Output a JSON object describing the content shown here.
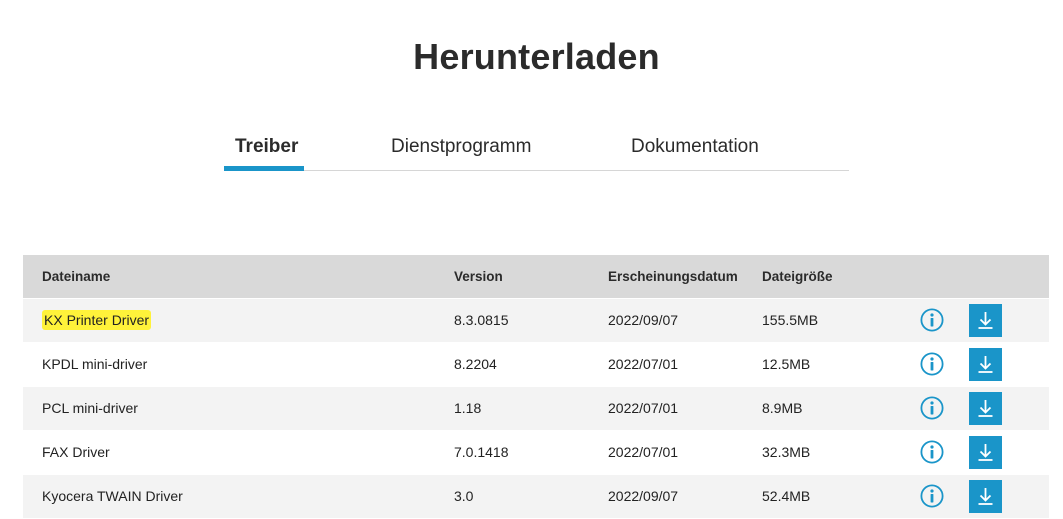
{
  "page": {
    "title": "Herunterladen"
  },
  "tabs": [
    {
      "label": "Treiber",
      "active": true
    },
    {
      "label": "Dienstprogramm",
      "active": false
    },
    {
      "label": "Dokumentation",
      "active": false
    }
  ],
  "table": {
    "headers": {
      "name": "Dateiname",
      "version": "Version",
      "date": "Erscheinungsdatum",
      "size": "Dateigröße"
    },
    "rows": [
      {
        "name": "KX Printer Driver",
        "version": "8.3.0815",
        "date": "2022/09/07",
        "size": "155.5MB",
        "highlighted": true
      },
      {
        "name": "KPDL mini-driver",
        "version": "8.2204",
        "date": "2022/07/01",
        "size": "12.5MB",
        "highlighted": false
      },
      {
        "name": "PCL mini-driver",
        "version": "1.18",
        "date": "2022/07/01",
        "size": "8.9MB",
        "highlighted": false
      },
      {
        "name": "FAX Driver",
        "version": "7.0.1418",
        "date": "2022/07/01",
        "size": "32.3MB",
        "highlighted": false
      },
      {
        "name": "Kyocera TWAIN Driver",
        "version": "3.0",
        "date": "2022/09/07",
        "size": "52.4MB",
        "highlighted": false
      }
    ]
  },
  "icons": {
    "info": "info-circle-icon",
    "download": "download-arrow-icon"
  },
  "colors": {
    "accent": "#1a95c9",
    "header_bg": "#d9d9d9",
    "row_bg": "#f3f3f3",
    "highlight": "#fff23a"
  }
}
